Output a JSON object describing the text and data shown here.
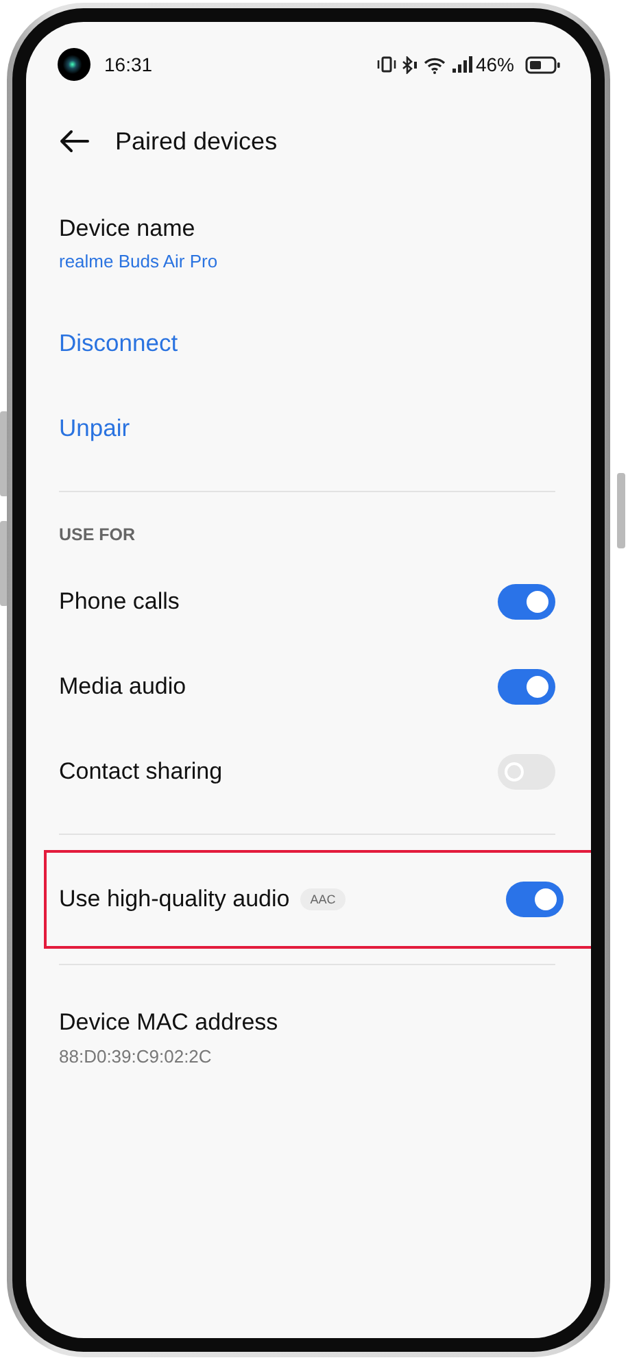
{
  "status_bar": {
    "time": "16:31",
    "battery": "46%"
  },
  "header": {
    "title": "Paired devices"
  },
  "device_name": {
    "label": "Device name",
    "value": "realme Buds Air Pro"
  },
  "actions": [
    "Disconnect",
    "Unpair"
  ],
  "section": {
    "title": "USE FOR"
  },
  "toggles": [
    {
      "label": "Phone calls",
      "on": true
    },
    {
      "label": "Media audio",
      "on": true
    },
    {
      "label": "Contact sharing",
      "on": false
    }
  ],
  "high_quality": {
    "label": "Use high-quality audio",
    "badge": "AAC",
    "on": true,
    "highlighted": true
  },
  "mac": {
    "label": "Device MAC address",
    "value": "88:D0:39:C9:02:2C"
  }
}
